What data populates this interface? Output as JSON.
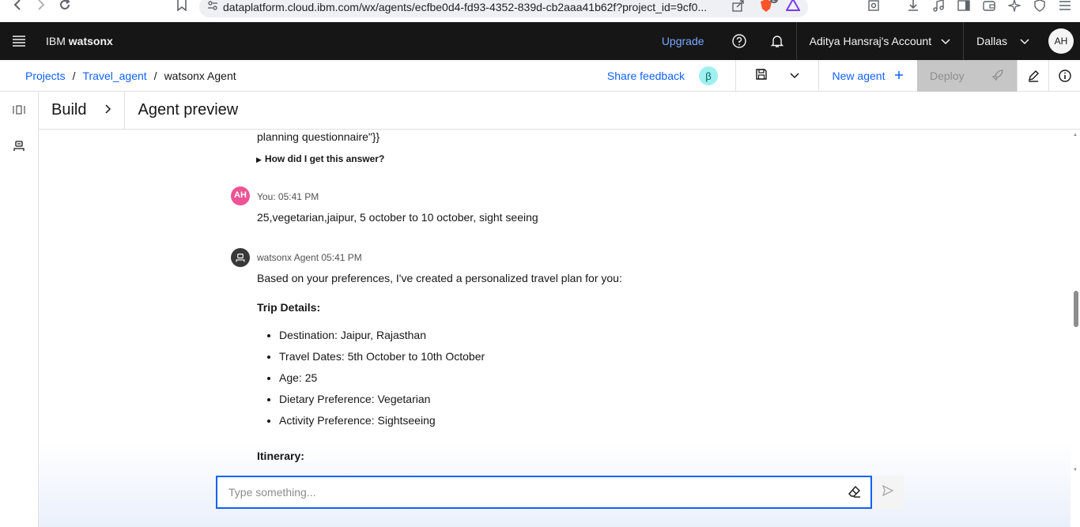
{
  "browser": {
    "url": "dataplatform.cloud.ibm.com/wx/agents/ecfbe0d4-fd93-4352-839d-cb2aaa41b62f?project_id=9cf0...",
    "badge_count": "2"
  },
  "header": {
    "brand_prefix": "IBM",
    "brand_name": "watsonx",
    "upgrade_label": "Upgrade",
    "account_label": "Aditya Hansraj's Account",
    "region_label": "Dallas",
    "avatar_initials": "AH"
  },
  "toolbar": {
    "breadcrumbs": [
      "Projects",
      "Travel_agent",
      "watsonx Agent"
    ],
    "share_feedback": "Share feedback",
    "beta_badge": "β",
    "new_agent_label": "New agent",
    "deploy_label": "Deploy"
  },
  "subheader": {
    "build_label": "Build",
    "preview_title": "Agent preview"
  },
  "chat": {
    "prev_tail": "planning questionnaire\"}}",
    "how_label": "How did I get this answer?",
    "user_msg": {
      "avatar": "AH",
      "meta": "You: 05:41 PM",
      "text": "25,vegetarian,jaipur, 5 october to 10 october, sight seeing"
    },
    "agent_msg": {
      "meta": "watsonx Agent 05:41 PM",
      "intro": "Based on your preferences, I've created a personalized travel plan for you:",
      "trip_heading": "Trip Details:",
      "details": [
        "Destination: Jaipur, Rajasthan",
        "Travel Dates: 5th October to 10th October",
        "Age: 25",
        "Dietary Preference: Vegetarian",
        "Activity Preference: Sightseeing"
      ],
      "itinerary_heading": "Itinerary:"
    }
  },
  "input": {
    "placeholder": "Type something...",
    "value": ""
  },
  "colors": {
    "accent": "#0f62fe",
    "header_bg": "#161616",
    "user_avatar": "#ee5396",
    "agent_avatar": "#393939"
  }
}
